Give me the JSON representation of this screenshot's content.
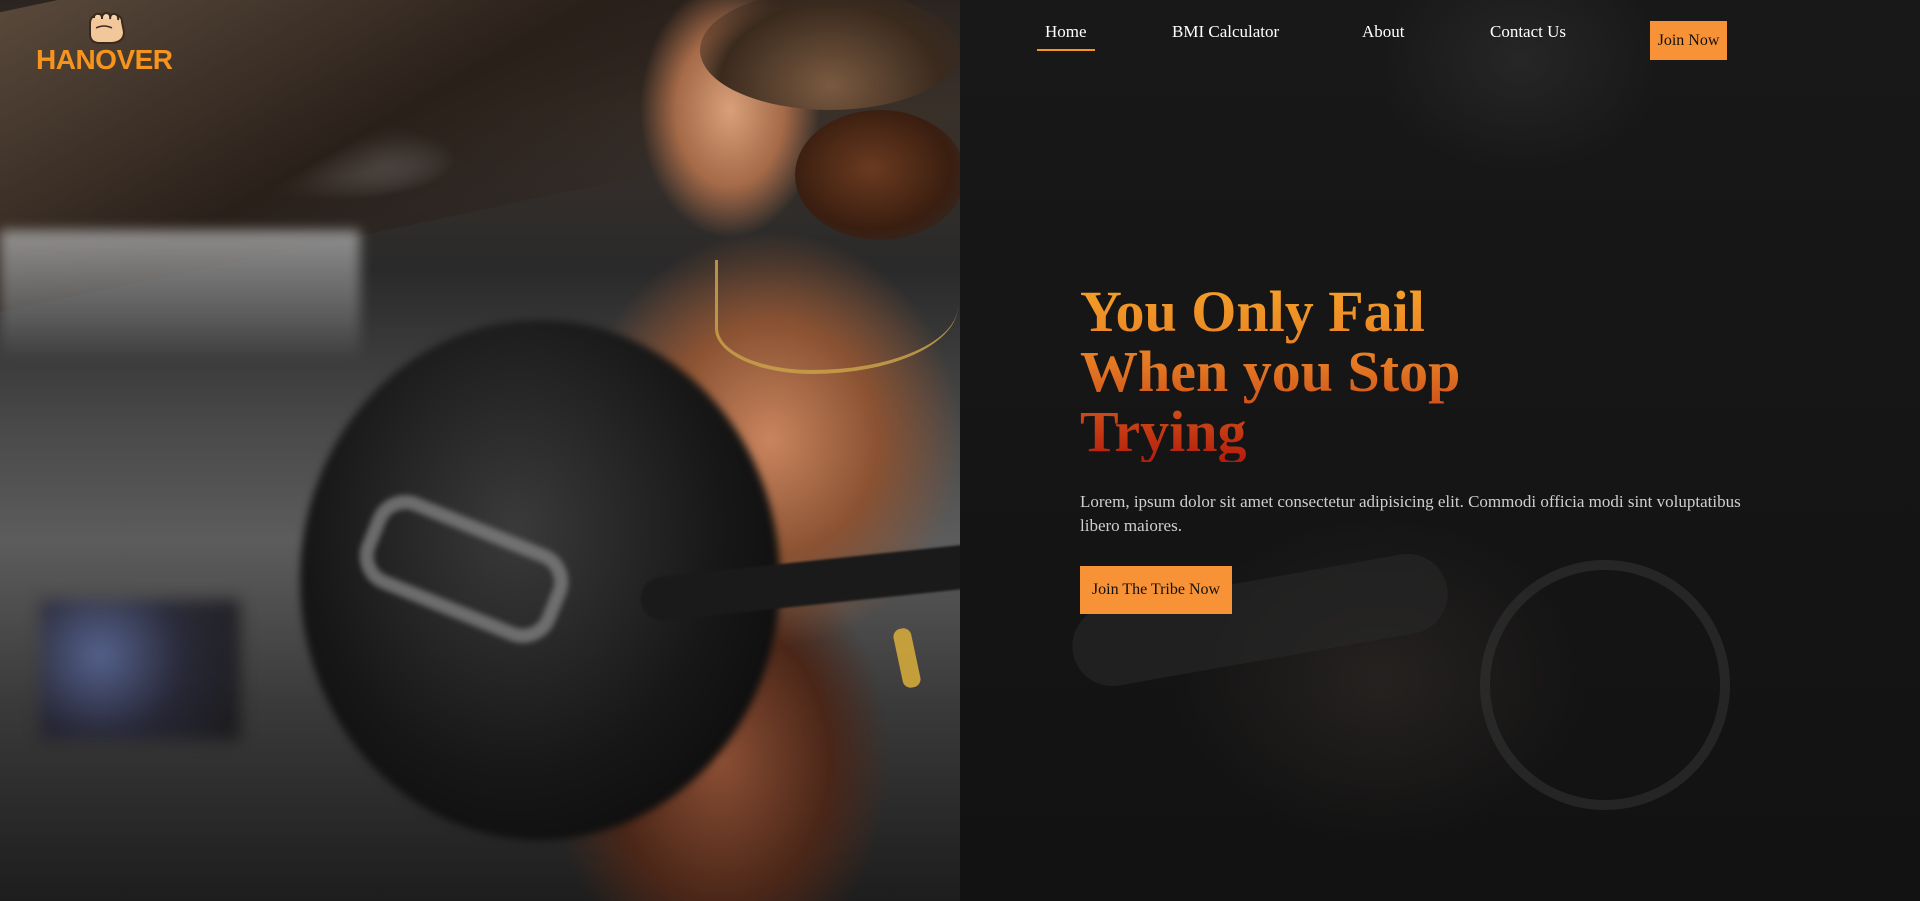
{
  "brand": {
    "logo_text": "HANOVER",
    "logo_icon": "fist-icon",
    "accent_color": "#f7941d"
  },
  "nav": {
    "items": [
      {
        "label": "Home",
        "active": true
      },
      {
        "label": "BMI Calculator",
        "active": false
      },
      {
        "label": "About",
        "active": false
      },
      {
        "label": "Contact Us",
        "active": false
      }
    ],
    "cta_label": "Join Now"
  },
  "hero": {
    "headline_lines": [
      "You Only Fail",
      "When you Stop",
      "Trying"
    ],
    "headline_gradient": [
      "#f6a228",
      "#e47a24",
      "#b51c0c"
    ],
    "description": "Lorem, ipsum dolor sit amet consectetur adipisicing elit. Commodi officia modi sint voluptatibus libero maiores.",
    "cta_label": "Join The Tribe Now"
  },
  "colors": {
    "panel_bg": "#151515",
    "button_bg": "#f79236",
    "text_light": "#ffffff",
    "text_muted": "#cfcfcf"
  }
}
